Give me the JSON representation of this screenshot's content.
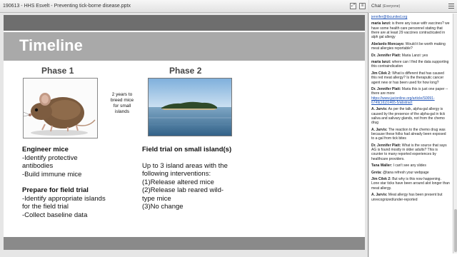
{
  "pod": {
    "title": "190613 - HHS Esvelt - Preventing tick-borne disease.pptx"
  },
  "slide": {
    "title": "Timeline",
    "phase1_heading": "Phase 1",
    "phase2_heading": "Phase 2",
    "years_note": [
      "2 years to",
      "breed mice",
      "for small",
      "islands"
    ],
    "col1": {
      "heading1": "Engineer mice",
      "lines1": [
        "-Identify protective",
        "antibodies",
        "-Build immune mice"
      ],
      "heading2": "Prepare for field trial",
      "lines2": [
        "-Identify appropriate islands",
        "for the field trial",
        "-Collect baseline data"
      ]
    },
    "col2": {
      "heading": "Field trial on small island(s)",
      "lines": [
        "Up to 3 island areas with the",
        "following interventions:",
        "(1)Release altered mice",
        "(2)Release lab reared wild-",
        "type mice",
        "(3)No change"
      ]
    }
  },
  "chat": {
    "title": "Chat",
    "subtitle": "(Everyone)",
    "top_link": "jennifer@tbcunited.org",
    "messages": [
      {
        "author": "maria lanzi:",
        "text": "is there any issue with vaccines? we have some health care personnel stating that there are at least 29 vaccines contracticated in alph gal allergy"
      },
      {
        "author": "Abelardo Moncayo:",
        "text": "Would it be worth making meat allergies reportable?"
      },
      {
        "author": "Dr. Jennifer Platt:",
        "text": "Maria Lanzi: yes"
      },
      {
        "author": "maria lanzi:",
        "text": "where can I find the data supporting this contraindication"
      },
      {
        "author": "Jim Cilek 2:",
        "text": "What is different that has caused this red meat allergy? Is the theraputic cancer agent new or has been used for how long?"
      },
      {
        "author": "Dr. Jennifer Platt:",
        "text": "Maria this is just one paper -- there are more"
      },
      {
        "author": "",
        "link": "https://www.jacionline.org/article/S0091-6749(16)31465-5/abstract"
      },
      {
        "author": "A. Jarvis:",
        "text": "As per the talk, alpha-gal allergy is caused by the presence of the alpha-gal in tick saliva and salivary glands, not from the chemo drug"
      },
      {
        "author": "A. Jarvis:",
        "text": "The reaction to the chemo drug was because these folks had already been exposed to a-gal from tick bites"
      },
      {
        "author": "Dr. Jennifer Platt:",
        "text": "What is the source that says AG is found mostly in older adults? This is counter to many reported experiences by healthcare providers."
      },
      {
        "author": "Tana Waller:",
        "text": "I can't see any slides"
      },
      {
        "author": "Greta:",
        "text": "@tana refresh your webpage"
      },
      {
        "author": "Jim Cilek 2:",
        "text": "But why is this now happening. Lone star ticks have been around alot longer than meat allergy."
      },
      {
        "author": "A. Jarvis:",
        "text": "Meat allergy has been present but unrecognized/under-reported"
      }
    ]
  },
  "colors": {
    "slide_topbar": "#6e6e6e",
    "slide_titlebar": "#a9a9a9",
    "link": "#1a4fb4"
  }
}
